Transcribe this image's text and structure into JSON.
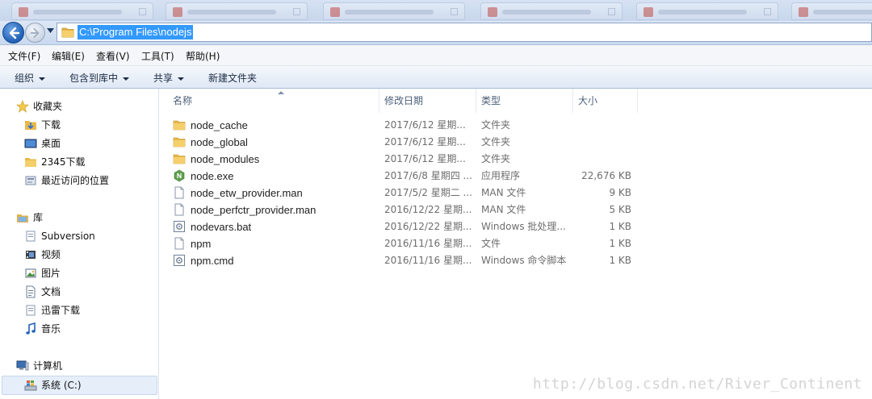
{
  "address": {
    "path": "C:\\Program Files\\nodejs"
  },
  "menu": [
    "文件(F)",
    "编辑(E)",
    "查看(V)",
    "工具(T)",
    "帮助(H)"
  ],
  "commands": {
    "organize": "组织",
    "include_library": "包含到库中",
    "share": "共享",
    "new_folder": "新建文件夹"
  },
  "nav": {
    "favorites": "收藏夹",
    "downloads": "下载",
    "desktop": "桌面",
    "dl2345": "2345下载",
    "recent": "最近访问的位置",
    "libraries": "库",
    "subversion": "Subversion",
    "videos": "视频",
    "pictures": "图片",
    "documents": "文档",
    "xunlei": "迅雷下载",
    "music": "音乐",
    "computer": "计算机",
    "system_drive": "系统 (C:)"
  },
  "columns": {
    "name": "名称",
    "date": "修改日期",
    "type": "类型",
    "size": "大小"
  },
  "files": [
    {
      "name": "node_cache",
      "date": "2017/6/12 星期...",
      "type": "文件夹",
      "size": "",
      "icon": "folder-icon"
    },
    {
      "name": "node_global",
      "date": "2017/6/12 星期...",
      "type": "文件夹",
      "size": "",
      "icon": "folder-icon"
    },
    {
      "name": "node_modules",
      "date": "2017/6/12 星期...",
      "type": "文件夹",
      "size": "",
      "icon": "folder-icon"
    },
    {
      "name": "node.exe",
      "date": "2017/6/8 星期四 ...",
      "type": "应用程序",
      "size": "22,676 KB",
      "icon": "nodejs-app-icon"
    },
    {
      "name": "node_etw_provider.man",
      "date": "2017/5/2 星期二 ...",
      "type": "MAN 文件",
      "size": "9 KB",
      "icon": "document-icon"
    },
    {
      "name": "node_perfctr_provider.man",
      "date": "2016/12/22 星期...",
      "type": "MAN 文件",
      "size": "5 KB",
      "icon": "document-icon"
    },
    {
      "name": "nodevars.bat",
      "date": "2016/12/22 星期...",
      "type": "Windows 批处理...",
      "size": "1 KB",
      "icon": "batch-file-icon"
    },
    {
      "name": "npm",
      "date": "2016/11/16 星期...",
      "type": "文件",
      "size": "1 KB",
      "icon": "document-icon"
    },
    {
      "name": "npm.cmd",
      "date": "2016/11/16 星期...",
      "type": "Windows 命令脚本",
      "size": "1 KB",
      "icon": "batch-file-icon"
    }
  ],
  "watermark": "http://blog.csdn.net/River_Continent"
}
